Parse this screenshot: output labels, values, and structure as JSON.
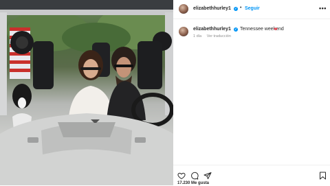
{
  "post": {
    "username": "elizabethhurley1",
    "follow_label": "Seguir",
    "more_label": "•••",
    "caption": "Tennessee weekend",
    "caption_emoji": "❤",
    "time_ago": "1 día",
    "translation_label": "Ver traducción",
    "likes_partial": "17.230 Me gusta"
  },
  "actions": {
    "icons": [
      "heart-icon",
      "comment-icon",
      "share-icon",
      "bookmark-icon"
    ]
  },
  "colors": {
    "link_blue": "#0095f6",
    "text": "#262626",
    "muted": "#8e8e8e",
    "heart_red": "#ed4956"
  }
}
